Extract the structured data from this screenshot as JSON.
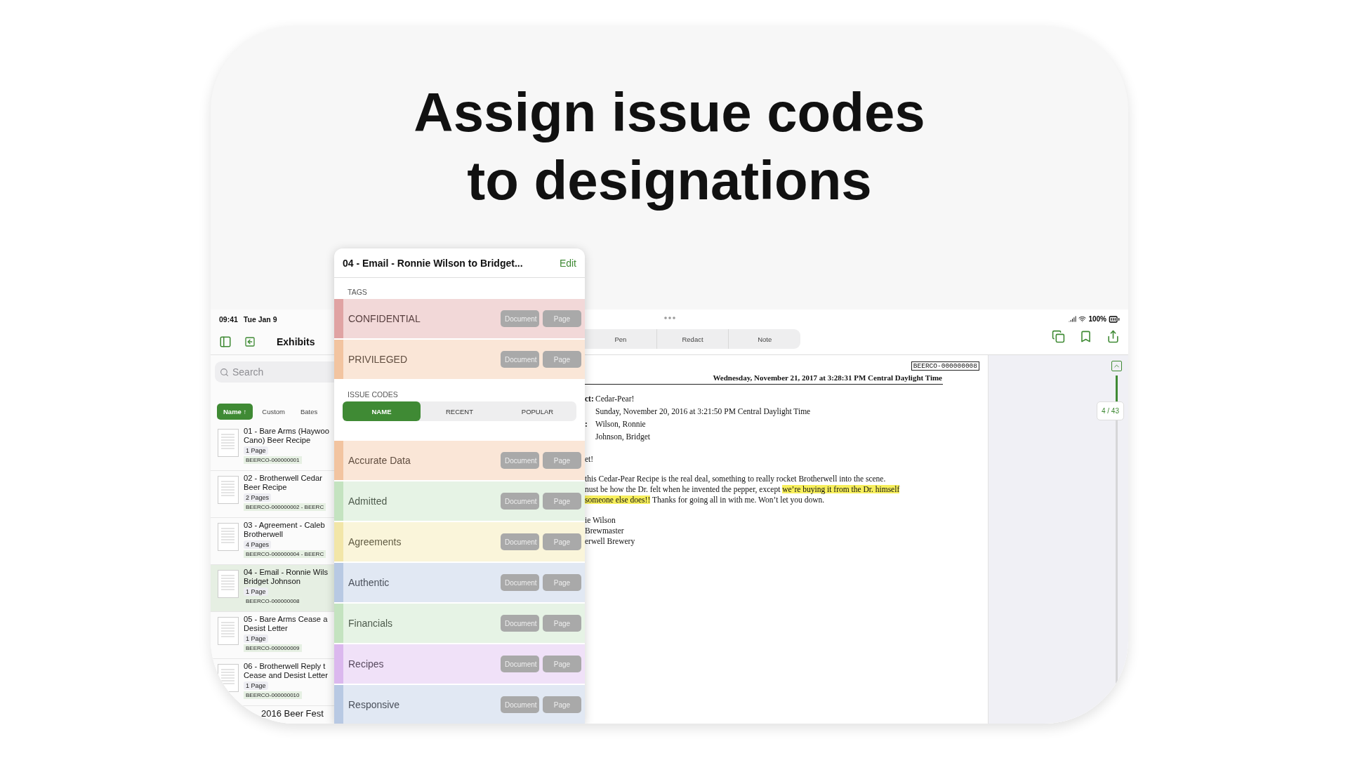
{
  "headline": [
    "Assign issue codes",
    "to designations"
  ],
  "status_bar": {
    "time": "09:41",
    "date": "Tue Jan 9",
    "battery": "100%"
  },
  "sidebar": {
    "title": "Exhibits",
    "search": {
      "placeholder": "Search"
    },
    "sort_tabs": [
      {
        "label": "Name ↑",
        "selected": true
      },
      {
        "label": "Custom",
        "selected": false
      },
      {
        "label": "Bates",
        "selected": false
      }
    ],
    "items": [
      {
        "title_lines": [
          "01 - Bare Arms (Haywoo",
          "Cano) Beer Recipe"
        ],
        "pages": "1 Page",
        "bates": "BEERCO-000000001",
        "selected": false
      },
      {
        "title_lines": [
          "02 - Brotherwell Cedar",
          "Beer Recipe"
        ],
        "pages": "2 Pages",
        "bates": "BEERCO-000000002 - BEERC",
        "selected": false
      },
      {
        "title_lines": [
          "03 - Agreement - Caleb",
          "Brotherwell"
        ],
        "pages": "4 Pages",
        "bates": "BEERCO-000000004 - BEERC",
        "selected": false
      },
      {
        "title_lines": [
          "04 - Email - Ronnie Wils",
          "Bridget Johnson"
        ],
        "pages": "1 Page",
        "bates": "BEERCO-000000008",
        "selected": true
      },
      {
        "title_lines": [
          "05 - Bare Arms Cease a",
          "Desist Letter"
        ],
        "pages": "1 Page",
        "bates": "BEERCO-000000009",
        "selected": false
      },
      {
        "title_lines": [
          "06 - Brotherwell Reply t",
          "Cease and Desist Letter"
        ],
        "pages": "1 Page",
        "bates": "BEERCO-000000010",
        "selected": false
      },
      {
        "title_lines": [
          "2016 Beer Fest"
        ],
        "selected": false
      }
    ]
  },
  "popover": {
    "title": "04 - Email - Ronnie Wilson to Bridget...",
    "edit": "Edit",
    "tags_label": "TAGS",
    "tags": [
      {
        "name": "CONFIDENTIAL",
        "color": "#e0a3a3",
        "buttons": [
          "Document",
          "Page"
        ]
      },
      {
        "name": "PRIVILEGED",
        "color": "#f2c4a0",
        "buttons": [
          "Document",
          "Page"
        ]
      }
    ],
    "issue_label": "ISSUE CODES",
    "issue_tabs": [
      {
        "label": "NAME",
        "selected": true
      },
      {
        "label": "RECENT",
        "selected": false
      },
      {
        "label": "POPULAR",
        "selected": false
      }
    ],
    "issue_codes": [
      {
        "name": "Accurate Data",
        "color": "#f2c4a0",
        "buttons": [
          "Document",
          "Page"
        ]
      },
      {
        "name": "Admitted",
        "color": "#c4e3c0",
        "buttons": [
          "Document",
          "Page"
        ]
      },
      {
        "name": "Agreements",
        "color": "#f2e6a8",
        "buttons": [
          "Document",
          "Page"
        ]
      },
      {
        "name": "Authentic",
        "color": "#b8c9e3",
        "buttons": [
          "Document",
          "Page"
        ]
      },
      {
        "name": "Financials",
        "color": "#c4e3c0",
        "buttons": [
          "Document",
          "Page"
        ]
      },
      {
        "name": "Recipes",
        "color": "#dbb8ee",
        "buttons": [
          "Document",
          "Page"
        ]
      },
      {
        "name": "Responsive",
        "color": "#b8c9e3",
        "buttons": [
          "Document",
          "Page"
        ]
      }
    ]
  },
  "document": {
    "tools": [
      {
        "label": "Pen",
        "selected": false
      },
      {
        "label": "Redact",
        "selected": false
      },
      {
        "label": "Note",
        "selected": false
      }
    ],
    "bates": "BEERCO-000000008",
    "header": "Wednesday, November 21, 2017 at 3:28:31 PM Central Daylight Time",
    "fields": [
      {
        "label": "ct:",
        "value": "Cedar-Pear!"
      },
      {
        "value": "Sunday, November 20, 2016 at 3:21:50 PM Central Daylight Time"
      },
      {
        "label": ":",
        "value": "Wilson, Ronnie"
      },
      {
        "value": "Johnson, Bridget"
      }
    ],
    "greeting": "et!",
    "paragraph": [
      [
        {
          "text": "this Cedar-Pear Recipe is the real deal, something to really rocket Brotherwell into the scene.",
          "highlighted": false
        }
      ],
      [
        {
          "text": "nust be how the Dr. felt when he invented the pepper, except ",
          "highlighted": false
        },
        {
          "text": "we’re buying it from the Dr. himself",
          "highlighted": true
        }
      ],
      [
        {
          "text": "someone else does!!",
          "highlighted": true
        },
        {
          "text": " Thanks for going all in with me. Won’t let you down.",
          "highlighted": false
        }
      ]
    ],
    "signature": [
      "ie Wilson",
      "Brewmaster",
      "erwell Brewery"
    ]
  },
  "page_rail": {
    "indicator": "4 / 43",
    "level": 0.1
  }
}
